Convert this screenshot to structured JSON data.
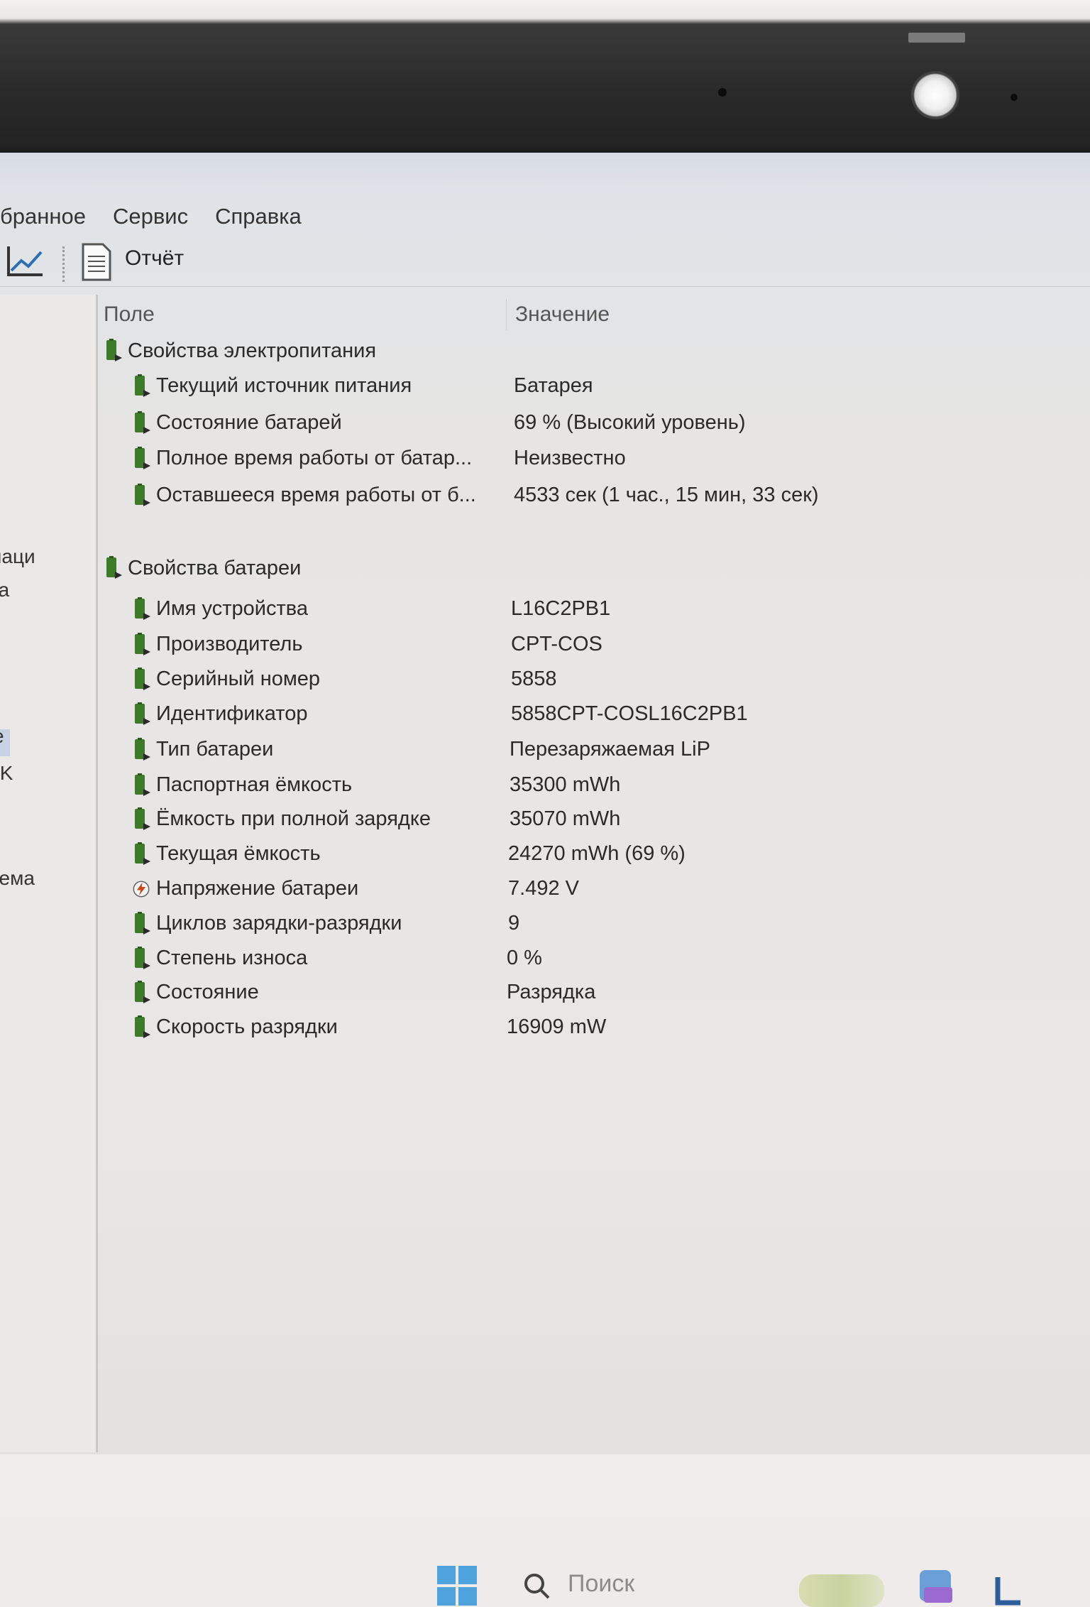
{
  "menu": [
    "бранное",
    "Сервис",
    "Справка"
  ],
  "toolbar": {
    "report_label": "Отчёт",
    "chart_icon": "chart-line-icon",
    "report_icon": "document-icon"
  },
  "left_panel": {
    "items": [
      "ормаци",
      "ра",
      "е",
      "IK",
      "стема"
    ]
  },
  "columns": {
    "field": "Поле",
    "value": "Значение"
  },
  "sections": [
    {
      "title": "Свойства электропитания",
      "rows": [
        {
          "field": "Текущий источник питания",
          "value": "Батарея"
        },
        {
          "field": "Состояние батарей",
          "value": "69 % (Высокий уровень)"
        },
        {
          "field": "Полное время работы от батар...",
          "value": "Неизвестно"
        },
        {
          "field": "Оставшееся время работы от б...",
          "value": "4533 сек (1 час., 15 мин, 33 сек)"
        }
      ]
    },
    {
      "title": "Свойства батареи",
      "rows": [
        {
          "field": "Имя устройства",
          "value": "L16C2PB1"
        },
        {
          "field": "Производитель",
          "value": "CPT-COS"
        },
        {
          "field": "Серийный номер",
          "value": "5858"
        },
        {
          "field": "Идентификатор",
          "value": "5858CPT-COSL16C2PB1"
        },
        {
          "field": "Тип батареи",
          "value": "Перезаряжаемая LiP"
        },
        {
          "field": "Паспортная ёмкость",
          "value": "35300 mWh"
        },
        {
          "field": "Ёмкость при полной зарядке",
          "value": "35070 mWh"
        },
        {
          "field": "Текущая ёмкость",
          "value": "24270 mWh  (69 %)"
        },
        {
          "field": "Напряжение батареи",
          "value": "7.492 V",
          "icon": "voltage"
        },
        {
          "field": "Циклов зарядки-разрядки",
          "value": "9"
        },
        {
          "field": "Степень износа",
          "value": "0 %"
        },
        {
          "field": "Состояние",
          "value": "Разрядка"
        },
        {
          "field": "Скорость разрядки",
          "value": "16909 mW"
        }
      ]
    }
  ],
  "taskbar": {
    "search_placeholder": "Поиск"
  },
  "colors": {
    "battery_icon": "#3d7a2a",
    "voltage_icon": "#c84a1a",
    "text": "#2a2a2a"
  }
}
